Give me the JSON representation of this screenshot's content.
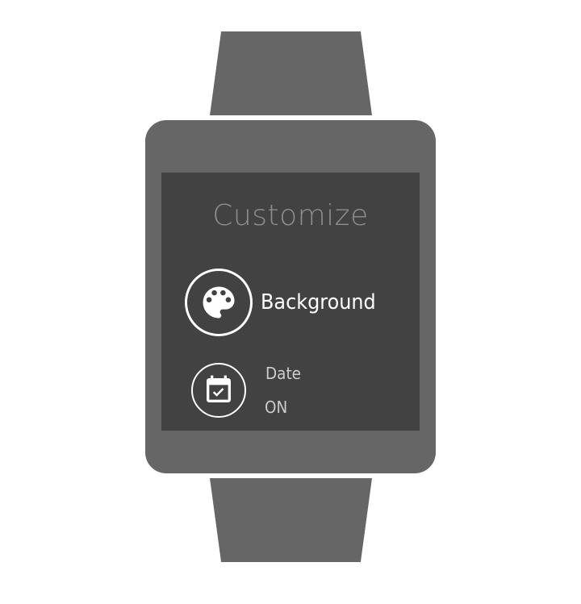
{
  "screen": {
    "title": "Customize"
  },
  "options": [
    {
      "icon": "palette-icon",
      "label": "Background"
    },
    {
      "icon": "calendar-check-icon",
      "label": "Date",
      "value": "ON"
    }
  ],
  "colors": {
    "device_body": "#666666",
    "screen_background": "#424242",
    "title_text": "#8e8e8e",
    "primary_text": "#ffffff",
    "secondary_text": "#cccccc"
  }
}
